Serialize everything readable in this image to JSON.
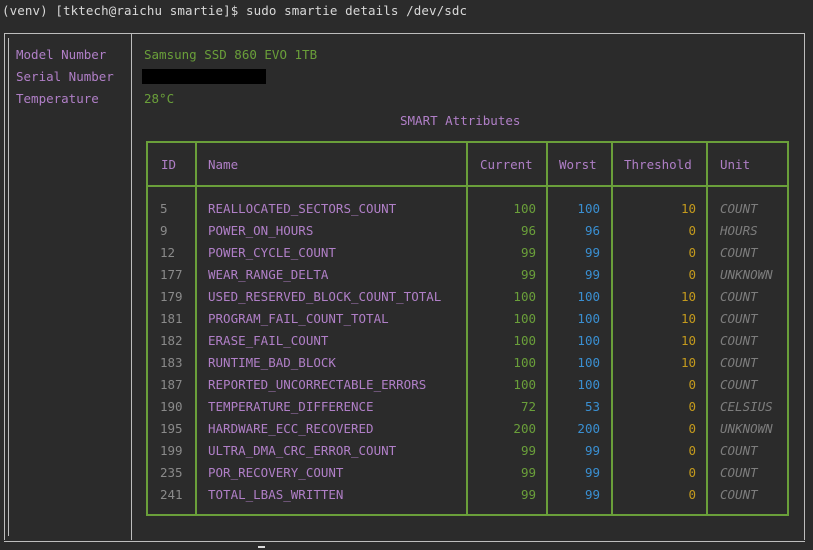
{
  "terminal": {
    "prompt": "(venv) [tktech@raichu smartie]$ sudo smartie details /dev/sdc"
  },
  "device": {
    "rows": [
      {
        "label": "Model Number",
        "value": "Samsung SSD 860 EVO 1TB"
      },
      {
        "label": "Serial Number",
        "value": ""
      },
      {
        "label": "Temperature",
        "value": "28°C"
      }
    ]
  },
  "smart": {
    "title": "SMART Attributes",
    "headers": {
      "id": "ID",
      "name": "Name",
      "current": "Current",
      "worst": "Worst",
      "threshold": "Threshold",
      "unit": "Unit"
    },
    "rows": [
      {
        "id": "5",
        "name": "REALLOCATED_SECTORS_COUNT",
        "current": "100",
        "worst": "100",
        "threshold": "10",
        "unit": "COUNT"
      },
      {
        "id": "9",
        "name": "POWER_ON_HOURS",
        "current": "96",
        "worst": "96",
        "threshold": "0",
        "unit": "HOURS"
      },
      {
        "id": "12",
        "name": "POWER_CYCLE_COUNT",
        "current": "99",
        "worst": "99",
        "threshold": "0",
        "unit": "COUNT"
      },
      {
        "id": "177",
        "name": "WEAR_RANGE_DELTA",
        "current": "99",
        "worst": "99",
        "threshold": "0",
        "unit": "UNKNOWN"
      },
      {
        "id": "179",
        "name": "USED_RESERVED_BLOCK_COUNT_TOTAL",
        "current": "100",
        "worst": "100",
        "threshold": "10",
        "unit": "COUNT"
      },
      {
        "id": "181",
        "name": "PROGRAM_FAIL_COUNT_TOTAL",
        "current": "100",
        "worst": "100",
        "threshold": "10",
        "unit": "COUNT"
      },
      {
        "id": "182",
        "name": "ERASE_FAIL_COUNT",
        "current": "100",
        "worst": "100",
        "threshold": "10",
        "unit": "COUNT"
      },
      {
        "id": "183",
        "name": "RUNTIME_BAD_BLOCK",
        "current": "100",
        "worst": "100",
        "threshold": "10",
        "unit": "COUNT"
      },
      {
        "id": "187",
        "name": "REPORTED_UNCORRECTABLE_ERRORS",
        "current": "100",
        "worst": "100",
        "threshold": "0",
        "unit": "COUNT"
      },
      {
        "id": "190",
        "name": "TEMPERATURE_DIFFERENCE",
        "current": "72",
        "worst": "53",
        "threshold": "0",
        "unit": "CELSIUS"
      },
      {
        "id": "195",
        "name": "HARDWARE_ECC_RECOVERED",
        "current": "200",
        "worst": "200",
        "threshold": "0",
        "unit": "UNKNOWN"
      },
      {
        "id": "199",
        "name": "ULTRA_DMA_CRC_ERROR_COUNT",
        "current": "99",
        "worst": "99",
        "threshold": "0",
        "unit": "COUNT"
      },
      {
        "id": "235",
        "name": "POR_RECOVERY_COUNT",
        "current": "99",
        "worst": "99",
        "threshold": "0",
        "unit": "COUNT"
      },
      {
        "id": "241",
        "name": "TOTAL_LBAS_WRITTEN",
        "current": "99",
        "worst": "99",
        "threshold": "0",
        "unit": "COUNT"
      }
    ]
  },
  "colors": {
    "label": "#b07fc7",
    "current": "#6a9f3a",
    "worst": "#3a8fd1",
    "threshold": "#c49a1d",
    "border": "#6a9f3a"
  }
}
